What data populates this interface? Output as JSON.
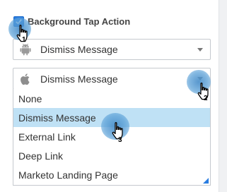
{
  "background_tap": {
    "checkbox_label": "Background Tap Action",
    "checked": true
  },
  "android_select": {
    "icon": "android-icon",
    "value": "Dismiss Message"
  },
  "ios_select": {
    "icon": "apple-icon",
    "value": "Dismiss Message",
    "expanded": true
  },
  "dropdown": {
    "options": [
      "None",
      "Dismiss Message",
      "External Link",
      "Deep Link",
      "Marketo Landing Page"
    ],
    "selected": "Dismiss Message"
  },
  "annotations": {
    "steps": [
      "1",
      "2",
      "3"
    ],
    "marker_icon": "hand-pointer-icon"
  },
  "colors": {
    "accent": "#2a7de1",
    "selected_option": "#bfe1f5",
    "click_marker": "#5aa0d7"
  }
}
